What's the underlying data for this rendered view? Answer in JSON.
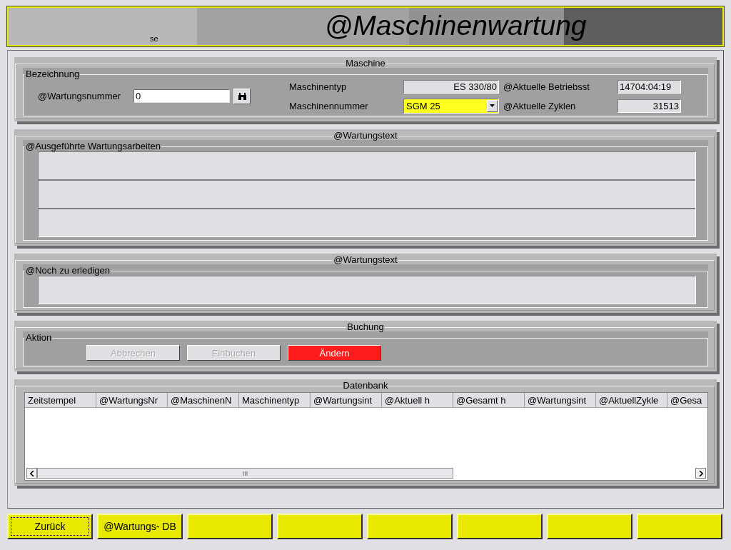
{
  "header": {
    "subtitle": "se",
    "title": "@Maschinenwartung"
  },
  "machine_section": {
    "title": "Maschine",
    "group": "Bezeichnung",
    "maintenance_number": {
      "label": "@Wartungsnummer",
      "value": "0"
    },
    "machine_type": {
      "label": "Maschinentyp",
      "value": "ES 330/80"
    },
    "machine_number": {
      "label": "Maschinennummer",
      "value": "SGM 25"
    },
    "operating_hours": {
      "label": "@Aktuelle Betriebsst",
      "value": "14704:04:19"
    },
    "cycles": {
      "label": "@Aktuelle Zyklen",
      "value": "31513"
    }
  },
  "text_sections": [
    {
      "title": "@Wartungstext",
      "group": "@Ausgeführte Wartungsarbeiten",
      "kind": "multi_line"
    },
    {
      "title": "@Wartungstext",
      "group": "@Noch zu erledigen",
      "kind": "single_line"
    }
  ],
  "booking_section": {
    "title": "Buchung",
    "group": "Aktion",
    "buttons": [
      {
        "label": "Abbrechen",
        "disabled": true,
        "kind": "normal"
      },
      {
        "label": "Einbuchen",
        "disabled": true,
        "kind": "normal"
      },
      {
        "label": "Ändern",
        "disabled": false,
        "kind": "alert"
      }
    ]
  },
  "database_section": {
    "title": "Datenbank",
    "columns": [
      "Zeitstempel",
      "@WartungsNr",
      "@MaschinenN",
      "Maschinentyp",
      "@Wartungsint",
      "@Aktuell h",
      "@Gesamt h",
      "@Wartungsint",
      "@AktuellZykle",
      "@Gesa"
    ]
  },
  "footer_buttons": [
    {
      "label": "Zurück",
      "focused": true
    },
    {
      "label": "@Wartungs- DB",
      "focused": false
    },
    {
      "focused": false
    },
    {
      "focused": false
    },
    {
      "focused": false
    },
    {
      "focused": false
    },
    {
      "focused": false
    },
    {
      "focused": false
    }
  ]
}
